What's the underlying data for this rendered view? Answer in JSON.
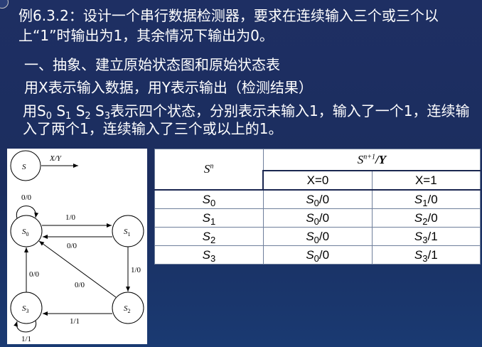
{
  "title": "例6.3.2：设计一个串行数据检测器，要求在连续输入三个或三个以上“1”时输出为1，其余情况下输出为0。",
  "lines": {
    "step1": "一、抽象、建立原始状态图和原始状态表",
    "xy_def": "用X表示输入数据，用Y表示输出（检测结果）",
    "states_prefix": "用",
    "states_desc": "表示四个状态，分别表示未输入1，输入了一个1，连续输入了两个1，连续输入了三个或以上的1。",
    "state_names": [
      "S",
      "S",
      "S",
      "S"
    ],
    "state_subs": [
      "0",
      "1",
      "2",
      "3"
    ]
  },
  "diagram": {
    "legend_state": "S",
    "legend_label": "X/Y",
    "states": [
      {
        "name": "S",
        "sub": "0"
      },
      {
        "name": "S",
        "sub": "1"
      },
      {
        "name": "S",
        "sub": "2"
      },
      {
        "name": "S",
        "sub": "3"
      }
    ],
    "labels": {
      "self_s0": "0/0",
      "s0_s1": "1/0",
      "s1_s0": "0/0",
      "s1_s2": "1/0",
      "s2_s0": "0/0",
      "s3_s0": "0/0",
      "s2_s3": "1/1",
      "self_s3": "1/1"
    }
  },
  "table": {
    "row_header": "S",
    "row_header_sup": "n",
    "group_header": "S",
    "group_header_sup": "n+1",
    "group_header_suffix": "/Y",
    "col_x0": "X=0",
    "col_x1": "X=1",
    "rows": [
      {
        "state": "S",
        "sub": "0",
        "x0": "S",
        "x0_sub": "0",
        "x0_out": "/0",
        "x1": "S",
        "x1_sub": "1",
        "x1_out": "/0"
      },
      {
        "state": "S",
        "sub": "1",
        "x0": "S",
        "x0_sub": "0",
        "x0_out": "/0",
        "x1": "S",
        "x1_sub": "2",
        "x1_out": "/0"
      },
      {
        "state": "S",
        "sub": "2",
        "x0": "S",
        "x0_sub": "0",
        "x0_out": "/0",
        "x1": "S",
        "x1_sub": "3",
        "x1_out": "/1"
      },
      {
        "state": "S",
        "sub": "3",
        "x0": "S",
        "x0_sub": "0",
        "x0_out": "/0",
        "x1": "S",
        "x1_sub": "3",
        "x1_out": "/1"
      }
    ]
  }
}
